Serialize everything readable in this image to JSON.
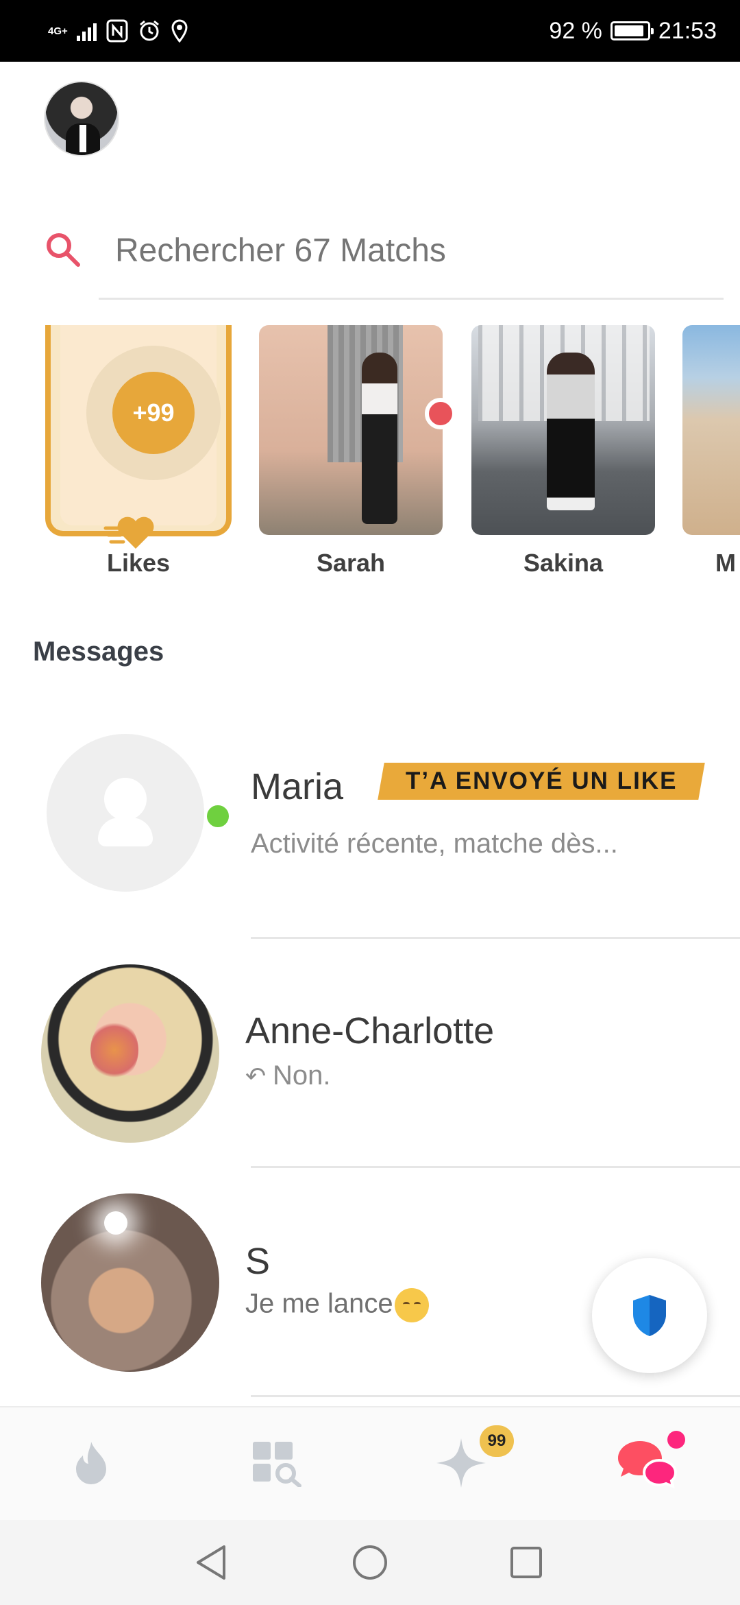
{
  "status_bar": {
    "network": "4G+",
    "battery": "92 %",
    "battery_level": 0.92,
    "time": "21:53"
  },
  "search": {
    "placeholder": "Rechercher 67 Matchs"
  },
  "matches": {
    "likes_count": "+99",
    "likes_label": "Likes",
    "items": [
      {
        "name": "Sarah"
      },
      {
        "name": "Sakina"
      },
      {
        "name": "M"
      }
    ]
  },
  "messages": {
    "title": "Messages",
    "items": [
      {
        "name": "Maria",
        "badge": "T’A ENVOYÉ UN LIKE",
        "preview": "Activité récente, matche dès..."
      },
      {
        "name": "Anne-Charlotte",
        "preview": "Non."
      },
      {
        "name": "S",
        "preview": "Je me lance"
      }
    ]
  },
  "bottom_nav": {
    "items": [
      {
        "icon": "flame-icon"
      },
      {
        "icon": "explore-icon"
      },
      {
        "icon": "sparkle-icon",
        "badge": "99"
      },
      {
        "icon": "chat-bubbles-icon"
      }
    ]
  },
  "colors": {
    "brand_gold": "#e7a73a",
    "brand_pink": "#fd267d",
    "online_green": "#6fd03f"
  }
}
